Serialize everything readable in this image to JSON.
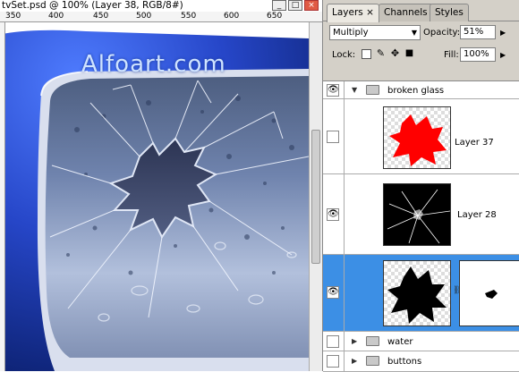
{
  "document": {
    "title": "tvSet.psd @ 100% (Layer 38, RGB/8#)",
    "ruler_ticks": [
      "350",
      "400",
      "450",
      "500",
      "550",
      "600",
      "650"
    ],
    "watermark": "Alfoart.com",
    "window_buttons": {
      "minimize": "_",
      "maximize": "□",
      "close": "×"
    }
  },
  "panel": {
    "tabs": [
      {
        "label": "Layers ×",
        "active": true
      },
      {
        "label": "Channels",
        "active": false
      },
      {
        "label": "Styles",
        "active": false
      }
    ],
    "blend_mode": "Multiply",
    "opacity_label": "Opacity:",
    "opacity_value": "51%",
    "lock_label": "Lock:",
    "fill_label": "Fill:",
    "fill_value": "100%",
    "layers": [
      {
        "name": "broken glass",
        "type": "group",
        "visible": true,
        "expanded": true
      },
      {
        "name": "Layer 37",
        "type": "layer",
        "visible": false,
        "thumb_color": "#ff0000"
      },
      {
        "name": "Layer 28",
        "type": "layer",
        "visible": true,
        "thumb_color": "#000000"
      },
      {
        "name": "",
        "type": "layer-mask",
        "visible": true,
        "selected": true,
        "thumb_color": "#000000"
      },
      {
        "name": "water",
        "type": "group",
        "visible": false,
        "expanded": false
      },
      {
        "name": "buttons",
        "type": "group",
        "visible": false,
        "expanded": false
      }
    ]
  },
  "colors": {
    "selection": "#3c8fe5",
    "tv_frame": "#2a4fbf"
  }
}
